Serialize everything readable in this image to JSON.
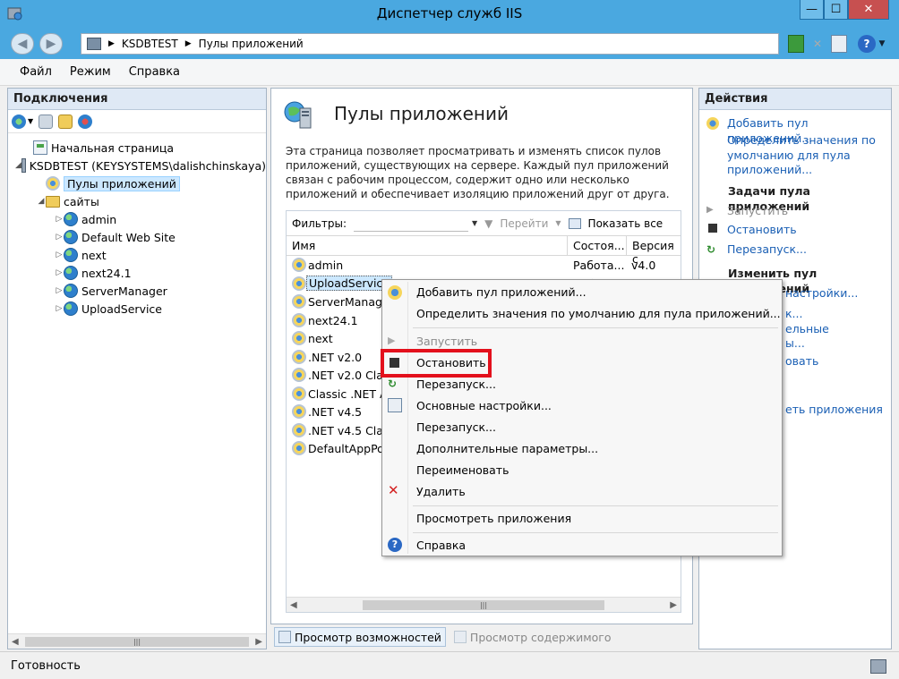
{
  "window": {
    "title": "Диспетчер служб IIS",
    "min_glyph": "—",
    "max_glyph": "☐",
    "close_glyph": "✕"
  },
  "address": {
    "crumbs": [
      "KSDBTEST",
      "Пулы приложений"
    ],
    "separator": "▶"
  },
  "menu": [
    "Файл",
    "Режим",
    "Справка"
  ],
  "connections": {
    "header": "Подключения",
    "tree": [
      {
        "label": "Начальная страница",
        "icon": "home-page-icon",
        "level": 1,
        "expander": ""
      },
      {
        "label": "KSDBTEST (KEYSYSTEMS\\dalishchinskaya)",
        "icon": "server-icon",
        "level": 1,
        "expander": "◢"
      },
      {
        "label": "Пулы приложений",
        "icon": "app-pool-icon",
        "level": 2,
        "expander": "",
        "selected": true
      },
      {
        "label": "сайты",
        "icon": "folder-icon",
        "level": 2,
        "expander": "◢"
      },
      {
        "label": "admin",
        "icon": "globe-icon",
        "level": 3,
        "expander": "▷"
      },
      {
        "label": "Default Web Site",
        "icon": "globe-icon",
        "level": 3,
        "expander": "▷"
      },
      {
        "label": "next",
        "icon": "globe-icon",
        "level": 3,
        "expander": "▷"
      },
      {
        "label": "next24.1",
        "icon": "globe-icon",
        "level": 3,
        "expander": "▷"
      },
      {
        "label": "ServerManager",
        "icon": "globe-icon",
        "level": 3,
        "expander": "▷"
      },
      {
        "label": "UploadService",
        "icon": "globe-icon",
        "level": 3,
        "expander": "▷"
      }
    ]
  },
  "main": {
    "title": "Пулы приложений",
    "description": "Эта страница позволяет просматривать и изменять список пулов приложений, существующих на сервере. Каждый пул приложений связан с рабочим процессом, содержит одно или несколько приложений и обеспечивает изоляцию приложений друг от друга.",
    "filter_label": "Фильтры:",
    "go_label": "Перейти",
    "show_all_label": "Показать все",
    "columns": [
      "Имя",
      "Состоя...",
      "Версия с"
    ],
    "rows": [
      {
        "name": "admin",
        "state": "Работа...",
        "version": "v4.0"
      },
      {
        "name": "UploadService",
        "state": "Рабо",
        "version": "",
        "selected": true
      },
      {
        "name": "ServerManager",
        "state": "",
        "version": ""
      },
      {
        "name": "next24.1",
        "state": "",
        "version": ""
      },
      {
        "name": "next",
        "state": "",
        "version": ""
      },
      {
        "name": ".NET v2.0",
        "state": "",
        "version": ""
      },
      {
        "name": ".NET v2.0 Class",
        "state": "",
        "version": ""
      },
      {
        "name": "Classic .NET Ap",
        "state": "",
        "version": ""
      },
      {
        "name": ".NET v4.5",
        "state": "",
        "version": ""
      },
      {
        "name": ".NET v4.5 Class",
        "state": "",
        "version": ""
      },
      {
        "name": "DefaultAppPoo",
        "state": "",
        "version": ""
      }
    ],
    "view_tabs": [
      "Просмотр возможностей",
      "Просмотр содержимого"
    ]
  },
  "actions": {
    "header": "Действия",
    "add_pool": "Добавить пул приложений...",
    "set_defaults": "Определить значения по умолчанию для пула приложений...",
    "tasks_header": "Задачи пула приложений",
    "start": "Запустить",
    "stop": "Остановить",
    "restart": "Перезапуск...",
    "edit_header": "Изменить пул приложений",
    "frag1": "настройки...",
    "frag2": "к...",
    "frag3": "ельные",
    "frag4": "ы...",
    "frag5": "овать",
    "frag6": "еть приложения"
  },
  "context_menu": {
    "items": [
      {
        "label": "Добавить пул приложений...",
        "icon": "add-pool-icon"
      },
      {
        "label": "Определить значения по умолчанию для пула приложений...",
        "icon": ""
      },
      {
        "label": "Запустить",
        "icon": "start-icon",
        "disabled": true
      },
      {
        "label": "Остановить",
        "icon": "stop-icon"
      },
      {
        "label": "Перезапуск...",
        "icon": "restart-icon"
      },
      {
        "label": "Основные настройки...",
        "icon": "settings-icon"
      },
      {
        "label": "Перезапуск...",
        "icon": ""
      },
      {
        "label": "Дополнительные параметры...",
        "icon": ""
      },
      {
        "label": "Переименовать",
        "icon": ""
      },
      {
        "label": "Удалить",
        "icon": "delete-icon"
      },
      {
        "label": "Просмотреть приложения",
        "icon": ""
      },
      {
        "label": "Справка",
        "icon": "help-icon"
      }
    ]
  },
  "status": {
    "text": "Готовность"
  },
  "colors": {
    "titlebar": "#4aa8e0",
    "link": "#1a5fb4",
    "highlight": "#e3101c"
  }
}
